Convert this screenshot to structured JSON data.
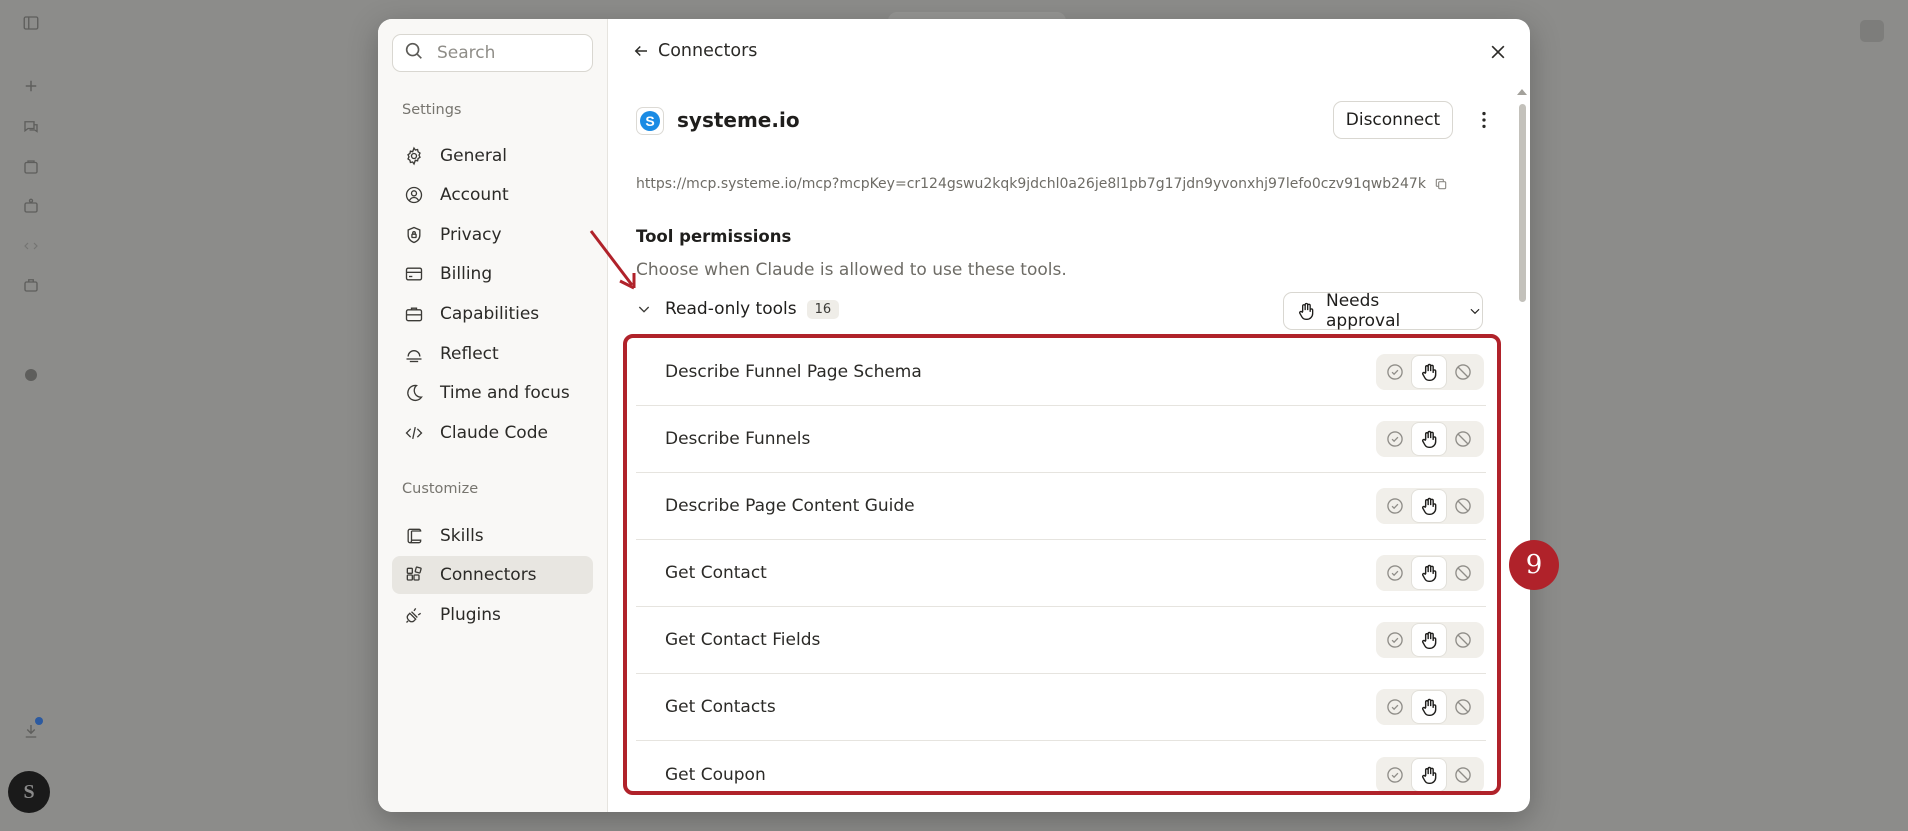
{
  "sidebar": {
    "search_placeholder": "Search",
    "section_settings": "Settings",
    "settings_items": [
      {
        "label": "General",
        "icon": "gear-icon"
      },
      {
        "label": "Account",
        "icon": "user-circle-icon"
      },
      {
        "label": "Privacy",
        "icon": "shield-lock-icon"
      },
      {
        "label": "Billing",
        "icon": "credit-card-icon"
      },
      {
        "label": "Capabilities",
        "icon": "briefcase-icon"
      },
      {
        "label": "Reflect",
        "icon": "sunrise-icon"
      },
      {
        "label": "Time and focus",
        "icon": "moon-icon"
      },
      {
        "label": "Claude Code",
        "icon": "code-icon"
      }
    ],
    "section_customize": "Customize",
    "customize_items": [
      {
        "label": "Skills",
        "icon": "scroll-icon"
      },
      {
        "label": "Connectors",
        "icon": "connectors-icon",
        "active": true
      },
      {
        "label": "Plugins",
        "icon": "plug-icon"
      }
    ]
  },
  "header": {
    "back_label": "Connectors"
  },
  "connector": {
    "name": "systeme.io",
    "logo_letter": "S",
    "disconnect_label": "Disconnect",
    "url": "https://mcp.systeme.io/mcp?mcpKey=cr124gswu2kqk9jdchl0a26je8l1pb7g17jdn9yvonxhj97lefo0czv91qwb247k"
  },
  "permissions": {
    "title": "Tool permissions",
    "subtitle": "Choose when Claude is allowed to use these tools.",
    "group_label": "Read-only tools",
    "group_count": "16",
    "group_setting": "Needs approval",
    "tools": [
      {
        "name": "Describe Funnel Page Schema",
        "state": "needs-approval"
      },
      {
        "name": "Describe Funnels",
        "state": "needs-approval"
      },
      {
        "name": "Describe Page Content Guide",
        "state": "needs-approval"
      },
      {
        "name": "Get Contact",
        "state": "needs-approval"
      },
      {
        "name": "Get Contact Fields",
        "state": "needs-approval"
      },
      {
        "name": "Get Contacts",
        "state": "needs-approval"
      },
      {
        "name": "Get Coupon",
        "state": "needs-approval"
      }
    ]
  },
  "annotation": {
    "badge": "9",
    "color": "#b0222a"
  },
  "rail": {
    "avatar_letter": "S"
  }
}
